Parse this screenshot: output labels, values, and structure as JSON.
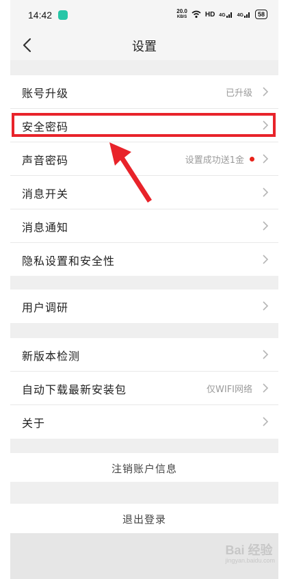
{
  "status_bar": {
    "time": "14:42",
    "speed": "20.0",
    "speed_unit": "KB/S",
    "network_1": "HD",
    "network_2": "4G",
    "network_3": "4G",
    "battery": "58",
    "app_icon_color": "#27c6a7"
  },
  "header": {
    "title": "设置"
  },
  "groups": [
    {
      "items": [
        {
          "label": "账号升级",
          "value": "已升级"
        },
        {
          "label": "安全密码"
        },
        {
          "label": "声音密码",
          "value": "设置成功送1金",
          "has_dot": true
        },
        {
          "label": "消息开关"
        },
        {
          "label": "消息通知"
        },
        {
          "label": "隐私设置和安全性"
        }
      ]
    },
    {
      "items": [
        {
          "label": "用户调研"
        }
      ]
    },
    {
      "items": [
        {
          "label": "新版本检测"
        },
        {
          "label": "自动下载最新安装包",
          "value": "仅WIFI网络"
        },
        {
          "label": "关于"
        }
      ]
    }
  ],
  "actions": {
    "cancel_account": "注销账户信息",
    "logout": "退出登录"
  },
  "annotation": {
    "color": "#e8232a"
  },
  "watermark": {
    "text": "Bai 经验",
    "sub": "jingyan.baidu.com"
  },
  "colors": {
    "dot": "#e8231a",
    "value_text": "#9a9a9a",
    "background": "#efefef"
  }
}
